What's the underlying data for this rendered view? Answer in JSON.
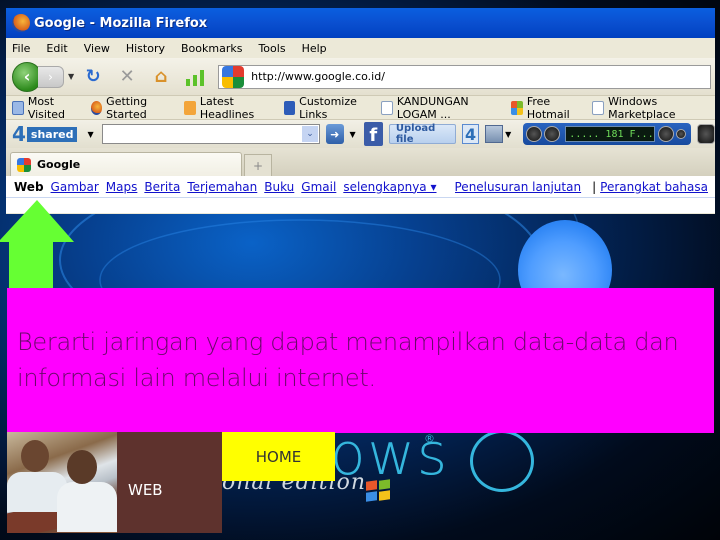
{
  "window": {
    "title": "Google - Mozilla Firefox"
  },
  "menu": [
    "File",
    "Edit",
    "View",
    "History",
    "Bookmarks",
    "Tools",
    "Help"
  ],
  "navigation": {
    "url": "http://www.google.co.id/",
    "icons": [
      "back-icon",
      "forward-icon",
      "history-dropdown-icon",
      "reload-icon",
      "stop-icon",
      "home-icon",
      "signal-bars-icon"
    ]
  },
  "bookmarks": [
    {
      "label": "Most Visited",
      "icon": "most-visited-icon"
    },
    {
      "label": "Getting Started",
      "icon": "firefox-icon"
    },
    {
      "label": "Latest Headlines",
      "icon": "rss-icon"
    },
    {
      "label": "Customize Links",
      "icon": "msn-icon"
    },
    {
      "label": "KANDUNGAN LOGAM ...",
      "icon": "page-icon"
    },
    {
      "label": "Free Hotmail",
      "icon": "windows-icon"
    },
    {
      "label": "Windows Marketplace",
      "icon": "page-icon"
    }
  ],
  "toolbar": {
    "brand_number": "4",
    "brand_word": "shared",
    "search_value": "",
    "upload_label": "Upload file",
    "four_label": "4",
    "player_display": "..... 181 F..."
  },
  "tabs": [
    {
      "label": "Google",
      "active": true
    }
  ],
  "new_tab_label": "+",
  "google_bar": {
    "active": "Web",
    "links": [
      "Gambar",
      "Maps",
      "Berita",
      "Terjemahan",
      "Buku",
      "Gmail",
      "selengkapnya ▾"
    ],
    "right_links": [
      "Penelusuran lanjutan",
      "Perangkat bahasa"
    ],
    "separator": "|"
  },
  "slide": {
    "definition": "Berarti jaringan yang dapat menampilkan data-data dan informasi lain melalui internet.",
    "web_label": "WEB",
    "home_label": "HOME",
    "wallpaper_text": "ows",
    "wallpaper_registered": "®",
    "wallpaper_edition": "onal edition",
    "colors": {
      "definition_box": "#ff00ff",
      "home_tile": "#ffff00",
      "web_tile": "#5e322d",
      "arrow": "#66ff33"
    }
  }
}
